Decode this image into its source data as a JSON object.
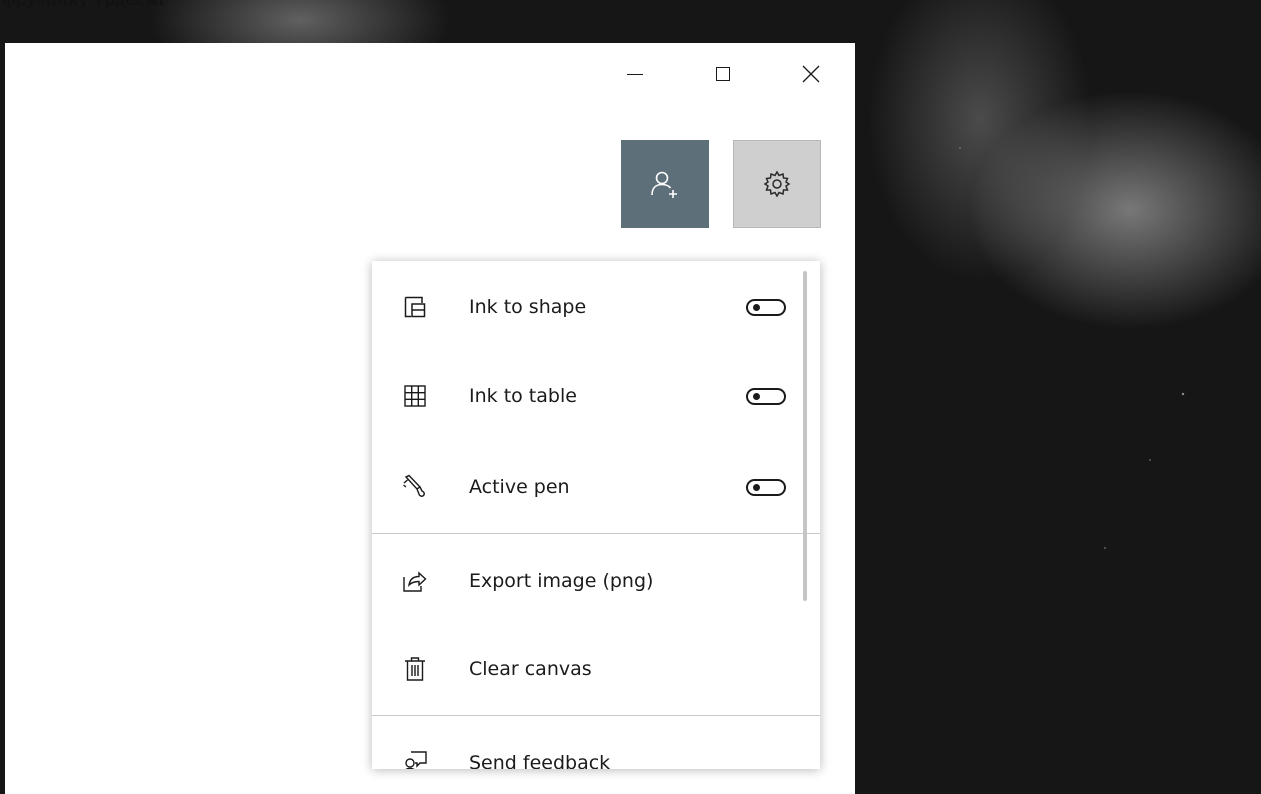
{
  "background_text": "фрузийку урдесмі",
  "window_controls": {
    "minimize": "minimize",
    "maximize": "maximize",
    "close": "close"
  },
  "toolbar": {
    "invite_icon": "add-person-icon",
    "settings_icon": "gear-icon"
  },
  "menu": {
    "items": [
      {
        "label": "Ink to shape",
        "icon": "ink-to-shape-icon",
        "toggle": false
      },
      {
        "label": "Ink to table",
        "icon": "table-grid-icon",
        "toggle": false
      },
      {
        "label": "Active pen",
        "icon": "pen-icon",
        "toggle": false
      },
      {
        "label": "Export image (png)",
        "icon": "share-export-icon"
      },
      {
        "label": "Clear canvas",
        "icon": "trash-icon"
      },
      {
        "label": "Send feedback",
        "icon": "feedback-icon"
      }
    ]
  },
  "colors": {
    "invite_button": "#5d6f78",
    "settings_button": "#cfcfcf"
  }
}
